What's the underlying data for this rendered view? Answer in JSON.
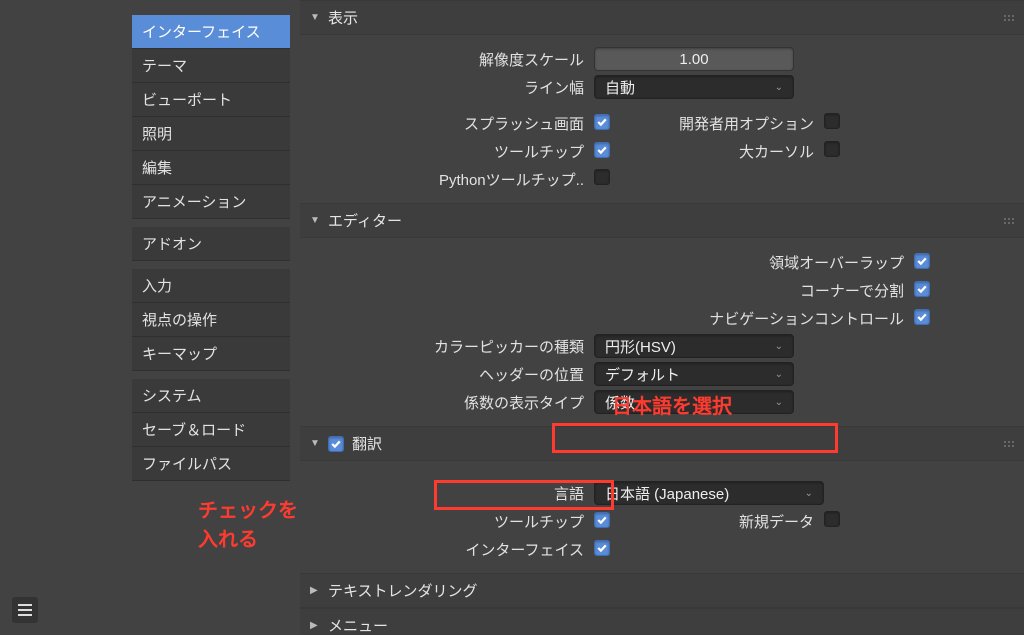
{
  "sidebar": {
    "groups": [
      [
        "インターフェイス",
        "テーマ",
        "ビューポート",
        "照明",
        "編集",
        "アニメーション"
      ],
      [
        "アドオン"
      ],
      [
        "入力",
        "視点の操作",
        "キーマップ"
      ],
      [
        "システム",
        "セーブ＆ロード",
        "ファイルパス"
      ]
    ],
    "selected": "インターフェイス"
  },
  "annotations": {
    "select_japanese": "日本語を選択",
    "check_on": "チェックを入れる"
  },
  "sections": {
    "display": {
      "title": "表示",
      "open": true,
      "res_scale_lbl": "解像度スケール",
      "res_scale_val": "1.00",
      "line_width_lbl": "ライン幅",
      "line_width_val": "自動",
      "splash_lbl": "スプラッシュ画面",
      "tooltips_lbl": "ツールチップ",
      "python_tt_lbl": "Pythonツールチップ..",
      "dev_extras_lbl": "開発者用オプション",
      "large_cursor_lbl": "大カーソル"
    },
    "editor": {
      "title": "エディター",
      "open": true,
      "region_overlap_lbl": "領域オーバーラップ",
      "split_corner_lbl": "コーナーで分割",
      "nav_ctrl_lbl": "ナビゲーションコントロール",
      "color_picker_lbl": "カラーピッカーの種類",
      "color_picker_val": "円形(HSV)",
      "header_pos_lbl": "ヘッダーの位置",
      "header_pos_val": "デフォルト",
      "factor_disp_lbl": "係数の表示タイプ",
      "factor_disp_val": "係数"
    },
    "translation": {
      "title": "翻訳",
      "open": true,
      "enabled": true,
      "language_lbl": "言語",
      "language_val": "日本語 (Japanese)",
      "tooltips_lbl": "ツールチップ",
      "newdata_lbl": "新規データ",
      "interface_lbl": "インターフェイス"
    },
    "text_render": {
      "title": "テキストレンダリング",
      "open": false
    },
    "menu": {
      "title": "メニュー",
      "open": false
    }
  }
}
